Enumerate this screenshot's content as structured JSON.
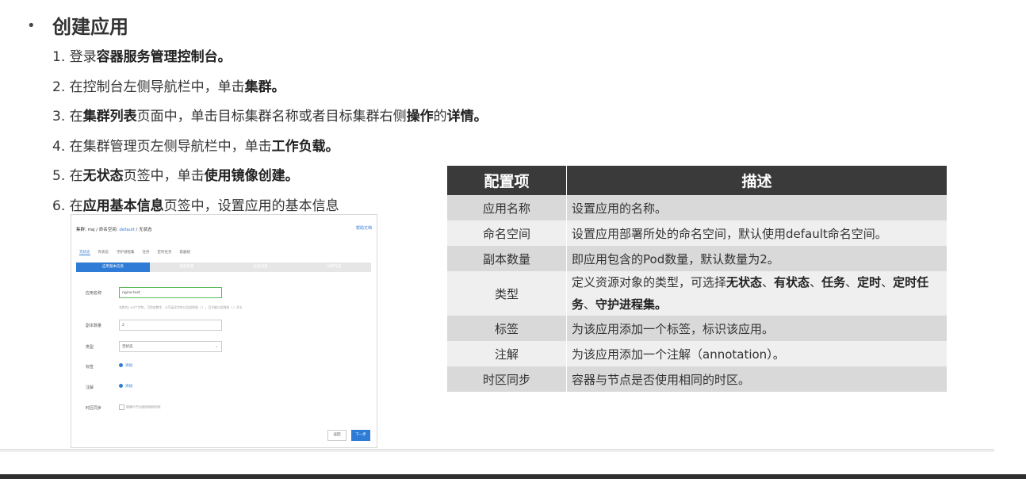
{
  "heading": {
    "bullet": "•",
    "title": "创建应用"
  },
  "steps": [
    {
      "num": "1.",
      "parts": [
        {
          "t": "登录",
          "b": false
        },
        {
          "t": "容器服务管理控制台。",
          "b": true
        }
      ]
    },
    {
      "num": "2.",
      "parts": [
        {
          "t": "在控制台左侧导航栏中，单击",
          "b": false
        },
        {
          "t": "集群。",
          "b": true
        }
      ]
    },
    {
      "num": "3.",
      "parts": [
        {
          "t": "在",
          "b": false
        },
        {
          "t": "集群列表",
          "b": true
        },
        {
          "t": "页面中，单击目标集群名称或者目标集群右侧",
          "b": false
        },
        {
          "t": "操作",
          "b": true
        },
        {
          "t": "的",
          "b": false
        },
        {
          "t": "详情。",
          "b": true
        }
      ]
    },
    {
      "num": "4.",
      "parts": [
        {
          "t": "在集群管理页左侧导航栏中，单击",
          "b": false
        },
        {
          "t": "工作负载。",
          "b": true
        }
      ]
    },
    {
      "num": "5.",
      "parts": [
        {
          "t": "在",
          "b": false
        },
        {
          "t": "无状态",
          "b": true
        },
        {
          "t": "页签中，单击",
          "b": false
        },
        {
          "t": "使用镜像创建。",
          "b": true
        }
      ]
    },
    {
      "num": "6.",
      "parts": [
        {
          "t": "在",
          "b": false
        },
        {
          "t": "应用基本信息",
          "b": true
        },
        {
          "t": "页签中，设置应用的基本信息",
          "b": false
        }
      ]
    }
  ],
  "mock": {
    "breadcrumb_prefix": "集群: mq / 命名空间:",
    "breadcrumb_link": "default",
    "breadcrumb_suffix": "/ 无状态",
    "help": "帮助文档",
    "tabs": [
      "无状态",
      "有状态",
      "守护进程集",
      "任务",
      "定时任务",
      "容器组"
    ],
    "steps": [
      "应用基本信息",
      "容器配置",
      "高级配置",
      "创建完成"
    ],
    "labels": {
      "name": "应用名称",
      "replicas": "副本数量",
      "type": "类型",
      "tag": "标签",
      "annotation": "注解",
      "timezone": "时区同步"
    },
    "name_value": "nginx-test",
    "hint": "名称为1-63个字符，可包含数字、小写英文字符以及短划线（-），且不能以短划线（-）开头",
    "replicas_value": "2",
    "type_value": "无状态",
    "add_label": "添加",
    "timezone_label": "容器与节点使用相同时区",
    "back": "返回",
    "next": "下一步"
  },
  "table": {
    "headers": [
      "配置项",
      "描述"
    ],
    "rows": [
      {
        "key": "应用名称",
        "desc": [
          {
            "t": "设置应用的名称。",
            "b": false
          }
        ]
      },
      {
        "key": "命名空间",
        "desc": [
          {
            "t": "设置应用部署所处的命名空间，默认使用default命名空间。",
            "b": false
          }
        ]
      },
      {
        "key": "副本数量",
        "desc": [
          {
            "t": "即应用包含的Pod数量，默认数量为2。",
            "b": false
          }
        ]
      },
      {
        "key": "类型",
        "desc": [
          {
            "t": "定义资源对象的类型，可选择",
            "b": false
          },
          {
            "t": "无状态",
            "b": true
          },
          {
            "t": "、",
            "b": false
          },
          {
            "t": "有状态",
            "b": true
          },
          {
            "t": "、",
            "b": false
          },
          {
            "t": "任务",
            "b": true
          },
          {
            "t": "、",
            "b": false
          },
          {
            "t": "定时",
            "b": true
          },
          {
            "t": "、",
            "b": false
          },
          {
            "t": "定时任务",
            "b": true
          },
          {
            "t": "、",
            "b": false
          },
          {
            "t": "守护进程集。",
            "b": true
          }
        ]
      },
      {
        "key": "标签",
        "desc": [
          {
            "t": "为该应用添加一个标签，标识该应用。",
            "b": false
          }
        ]
      },
      {
        "key": "注解",
        "desc": [
          {
            "t": "为该应用添加一个注解（annotation）。",
            "b": false
          }
        ]
      },
      {
        "key": "时区同步",
        "desc": [
          {
            "t": "容器与节点是否使用相同的时区。",
            "b": false
          }
        ]
      }
    ]
  },
  "colors": {
    "header_bg": "#3a3a3a",
    "row_odd": "#d9d9d9",
    "row_even": "#efefef",
    "accent": "#2f7cd6"
  }
}
